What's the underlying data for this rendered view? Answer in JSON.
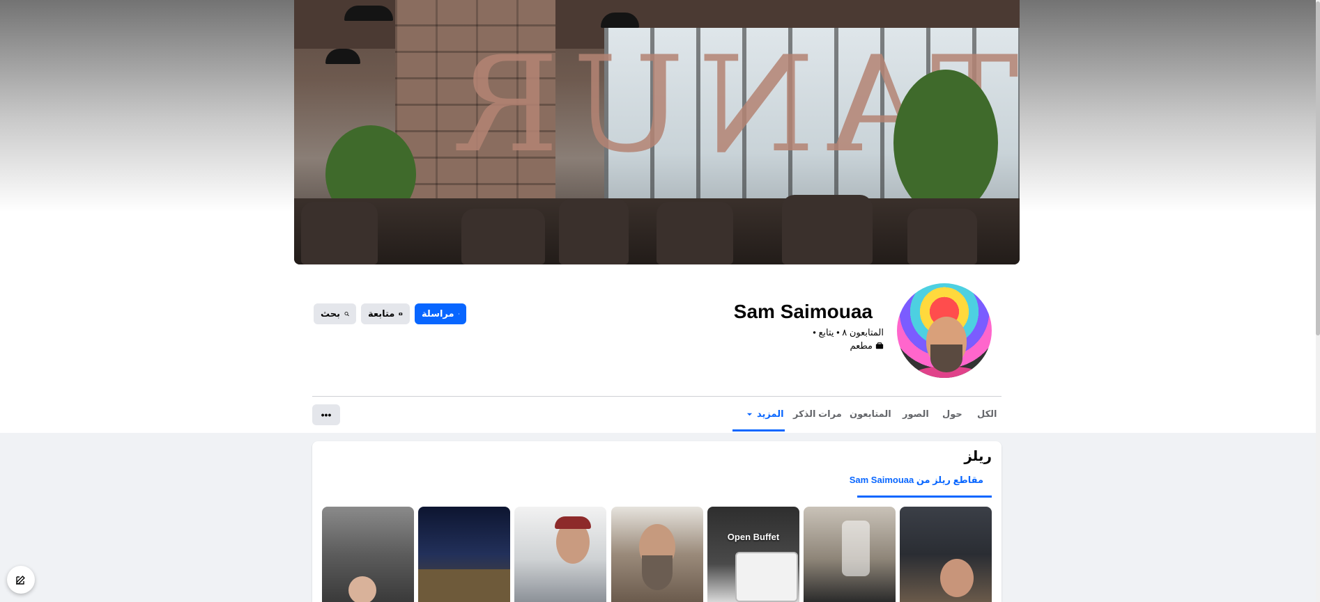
{
  "profile": {
    "name": "Sam Saimouaa",
    "stats": "المتابعون ٨ • يتابع •",
    "category": "مطعم"
  },
  "actions": {
    "message_label": "مراسلة",
    "follow_label": "متابعة",
    "search_label": "بحث"
  },
  "tabs": {
    "items": [
      {
        "label": "الكل"
      },
      {
        "label": "حول"
      },
      {
        "label": "الصور"
      },
      {
        "label": "المتابعون"
      },
      {
        "label": "مرات الذكر"
      },
      {
        "label": "المزيد"
      }
    ],
    "active_index": 5,
    "overflow_label": "•••"
  },
  "reels": {
    "title": "ريلز",
    "subtab_label": "مقاطع ريلز من  Sam Saimouaa",
    "captions": [
      "",
      "",
      "Open Buffet",
      "",
      "",
      "",
      ""
    ]
  },
  "colors": {
    "accent": "#0866ff",
    "secondary_button": "#e4e6eb",
    "page_bg": "#f0f2f5"
  },
  "icons": [
    "messenger-icon",
    "follow-icon",
    "search-icon",
    "category-icon",
    "caret-down-icon",
    "compose-icon"
  ]
}
